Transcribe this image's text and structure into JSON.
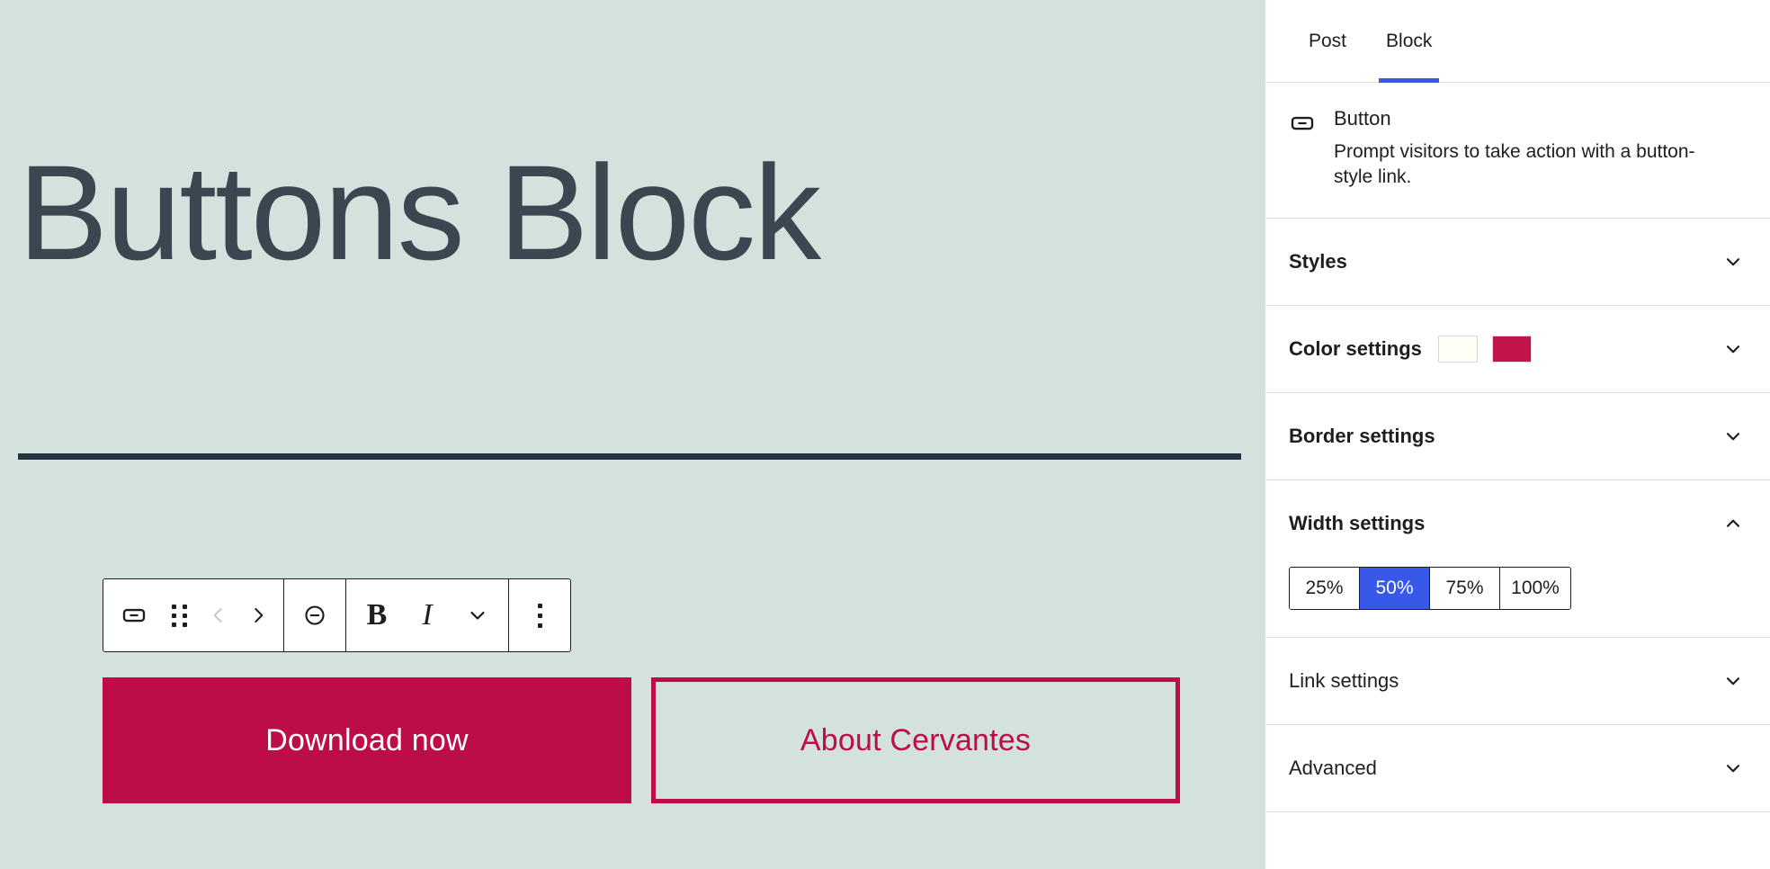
{
  "editor": {
    "post_title": "Buttons Block",
    "separator_name": "separator-block",
    "toolbar": {
      "groups": [
        {
          "items": [
            {
              "name": "block-type-button-icon",
              "label": "Button block type"
            },
            {
              "name": "drag-handle-icon",
              "label": "Drag"
            },
            {
              "name": "move-up-icon",
              "label": "Move left",
              "disabled": true
            },
            {
              "name": "move-down-icon",
              "label": "Move right",
              "disabled": false
            }
          ]
        },
        {
          "items": [
            {
              "name": "link-icon",
              "label": "Link"
            }
          ]
        },
        {
          "items": [
            {
              "name": "bold-icon",
              "label": "B"
            },
            {
              "name": "italic-icon",
              "label": "I"
            },
            {
              "name": "chevron-down-icon",
              "label": "More rich text controls"
            }
          ]
        },
        {
          "items": [
            {
              "name": "kebab-menu-icon",
              "label": "Options"
            }
          ]
        }
      ]
    },
    "buttons": [
      {
        "label": "Download now",
        "style": "fill"
      },
      {
        "label": "About Cervantes",
        "style": "outline"
      }
    ]
  },
  "sidebar": {
    "tabs": [
      {
        "label": "Post",
        "active": false
      },
      {
        "label": "Block",
        "active": true
      }
    ],
    "close_label": "✕",
    "block_card": {
      "title": "Button",
      "description": "Prompt visitors to take action with a button-style link."
    },
    "panels": [
      {
        "title": "Styles",
        "expanded": false
      },
      {
        "title": "Color settings",
        "expanded": false
      },
      {
        "title": "Border settings",
        "expanded": false
      },
      {
        "title": "Width settings",
        "expanded": true
      },
      {
        "title": "Link settings",
        "expanded": false
      },
      {
        "title": "Advanced",
        "expanded": false
      }
    ],
    "color_settings": {
      "swatches": [
        {
          "name": "background-color-swatch",
          "value": "#fffef5"
        },
        {
          "name": "text-color-swatch",
          "value": "#c2154b"
        }
      ]
    },
    "width_settings": {
      "options": [
        {
          "label": "25%",
          "selected": false
        },
        {
          "label": "50%",
          "selected": true
        },
        {
          "label": "75%",
          "selected": false
        },
        {
          "label": "100%",
          "selected": false
        }
      ]
    }
  },
  "colors": {
    "canvas_background": "#d3e2dc",
    "title_text": "#3c4650",
    "separator": "#253340",
    "button_fill": "#bd0d48",
    "accent_blue": "#3858e9"
  }
}
